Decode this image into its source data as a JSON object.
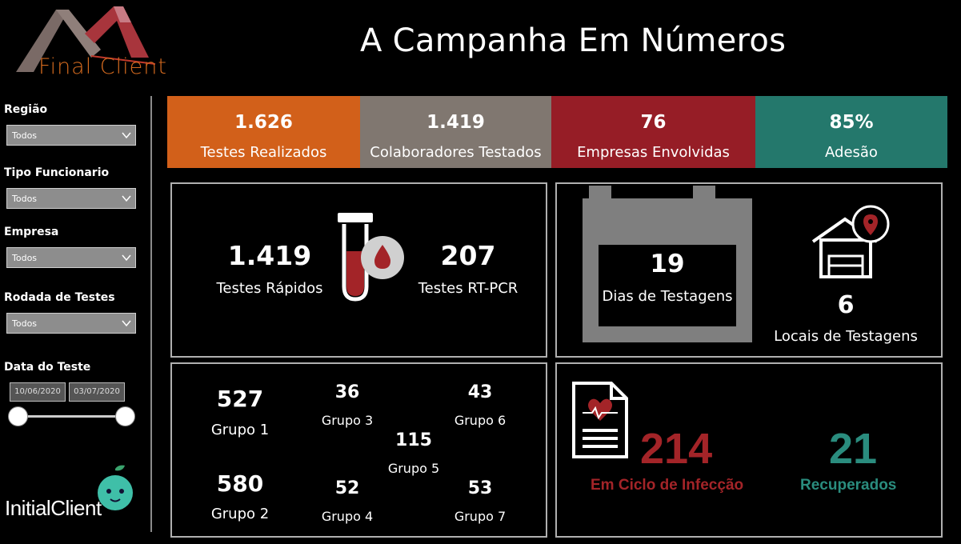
{
  "header": {
    "brand_logo": "Final Client",
    "title": "A Campanha Em Números"
  },
  "filters": {
    "regiao": {
      "label": "Região",
      "value": "Todos"
    },
    "tipo": {
      "label": "Tipo Funcionario",
      "value": "Todos"
    },
    "empresa": {
      "label": "Empresa",
      "value": "Todos"
    },
    "rodada": {
      "label": "Rodada de Testes",
      "value": "Todos"
    },
    "data": {
      "label": "Data do Teste",
      "start": "10/06/2020",
      "end": "03/07/2020"
    }
  },
  "footer_logo": "InitialClient",
  "kpis": [
    {
      "value": "1.626",
      "label": "Testes Realizados",
      "color": "#d2601a"
    },
    {
      "value": "1.419",
      "label": "Colaboradores Testados",
      "color": "#807770"
    },
    {
      "value": "76",
      "label": "Empresas Envolvidas",
      "color": "#961d26"
    },
    {
      "value": "85%",
      "label": "Adesão",
      "color": "#24786c"
    }
  ],
  "tests": {
    "rapid": {
      "value": "1.419",
      "label": "Testes Rápidos"
    },
    "pcr": {
      "value": "207",
      "label": "Testes RT-PCR"
    }
  },
  "testing": {
    "days": {
      "value": "19",
      "label": "Dias de Testagens"
    },
    "locations": {
      "value": "6",
      "label": "Locais de Testagens"
    }
  },
  "groups": [
    {
      "value": "527",
      "label": "Grupo 1"
    },
    {
      "value": "580",
      "label": "Grupo 2"
    },
    {
      "value": "36",
      "label": "Grupo 3"
    },
    {
      "value": "52",
      "label": "Grupo 4"
    },
    {
      "value": "115",
      "label": "Grupo 5"
    },
    {
      "value": "43",
      "label": "Grupo 6"
    },
    {
      "value": "53",
      "label": "Grupo 7"
    }
  ],
  "outcomes": {
    "infection": {
      "value": "214",
      "label": "Em Ciclo de Infecção"
    },
    "recovered": {
      "value": "21",
      "label": "Recuperados"
    }
  },
  "colors": {
    "infection": "#a32428",
    "recovered": "#2a8c7e",
    "panel_border": "#b0b0b0"
  }
}
